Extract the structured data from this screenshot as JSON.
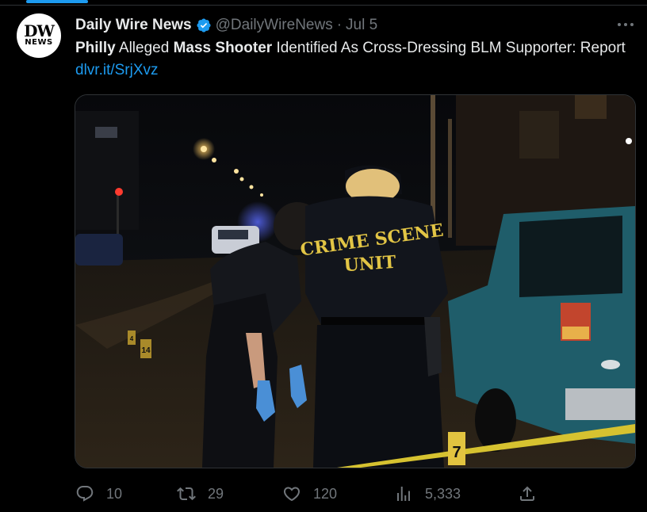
{
  "tweet": {
    "author_name": "Daily Wire News",
    "handle": "@DailyWireNews",
    "separator": "·",
    "date": "Jul 5",
    "avatar": {
      "line1": "DW",
      "line2": "NEWS"
    },
    "text_segments": [
      {
        "text": "Philly",
        "style": "bold"
      },
      {
        "text": " Alleged ",
        "style": "normal"
      },
      {
        "text": "Mass Shooter",
        "style": "bold"
      },
      {
        "text": " Identified As Cross-Dressing BLM Supporter: Report ",
        "style": "normal"
      },
      {
        "text": "dlvr.it/SrjXvz",
        "style": "link"
      }
    ],
    "media": {
      "vest_line1": "CRIME SCENE",
      "vest_line2": "UNIT",
      "markers": [
        "7",
        "14",
        "4"
      ]
    }
  },
  "actions": {
    "reply_count": "10",
    "retweet_count": "29",
    "like_count": "120",
    "views_count": "5,333"
  },
  "icons": {
    "verified": "verified-badge-icon",
    "more": "more-icon",
    "reply": "reply-icon",
    "retweet": "retweet-icon",
    "like": "heart-icon",
    "views": "views-icon",
    "share": "share-icon"
  },
  "colors": {
    "background": "#000000",
    "text": "#e7e9ea",
    "muted": "#71767b",
    "accent": "#1d9bf0"
  }
}
